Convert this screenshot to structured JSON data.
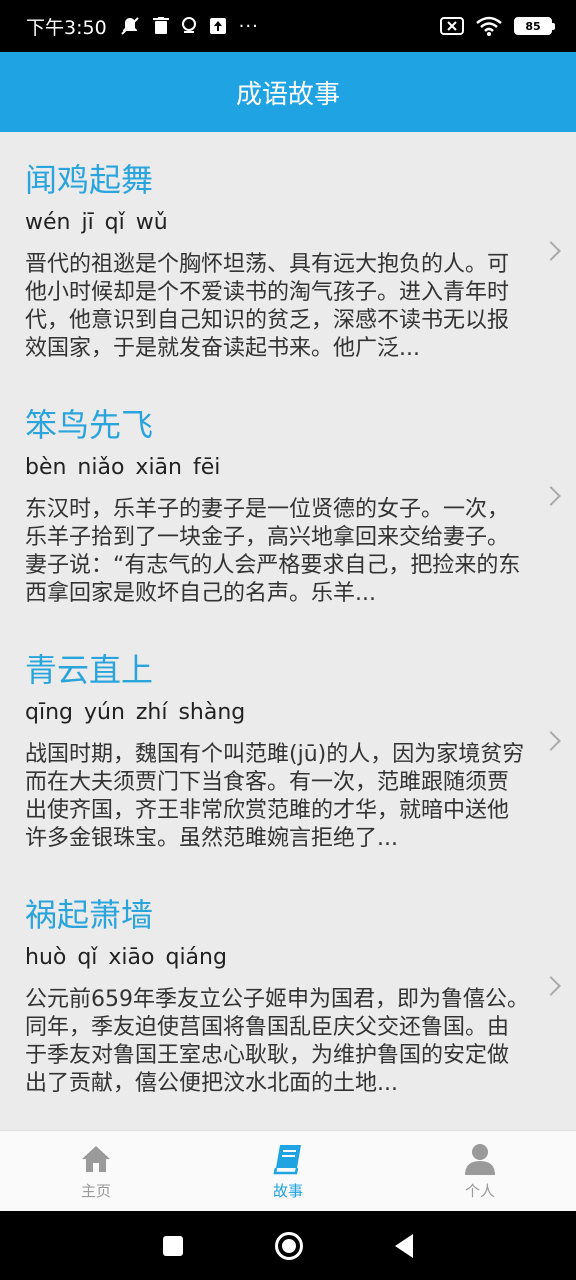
{
  "status_bar": {
    "time": "下午3:50",
    "more": "···",
    "battery": "85"
  },
  "app_bar": {
    "title": "成语故事"
  },
  "stories": [
    {
      "title": "闻鸡起舞",
      "pinyin": "wén jī qǐ wǔ",
      "text": "晋代的祖逖是个胸怀坦荡、具有远大抱负的人。可他小时候却是个不爱读书的淘气孩子。进入青年时代，他意识到自己知识的贫乏，深感不读书无以报效国家，于是就发奋读起书来。他广泛..."
    },
    {
      "title": "笨鸟先飞",
      "pinyin": "bèn niǎo xiān fēi",
      "text": "东汉时，乐羊子的妻子是一位贤德的女子。一次，乐羊子拾到了一块金子，高兴地拿回来交给妻子。妻子说：“有志气的人会严格要求自己，把捡来的东西拿回家是败坏自己的名声。乐羊..."
    },
    {
      "title": "青云直上",
      "pinyin": "qīng yún zhí shàng",
      "text": "战国时期，魏国有个叫范雎(jū)的人，因为家境贫穷而在大夫须贾门下当食客。有一次，范雎跟随须贾出使齐国，齐王非常欣赏范雎的才华，就暗中送他许多金银珠宝。虽然范雎婉言拒绝了..."
    },
    {
      "title": "祸起萧墙",
      "pinyin": "huò qǐ xiāo qiáng",
      "text": "公元前659年季友立公子姬申为国君，即为鲁僖公。同年，季友迫使莒国将鲁国乱臣庆父交还鲁国。由于季友对鲁国王室忠心耿耿，为维护鲁国的安定做出了贡献，僖公便把汶水北面的土地..."
    }
  ],
  "tabs": [
    {
      "label": "主页",
      "icon": "home-icon"
    },
    {
      "label": "故事",
      "icon": "book-icon",
      "active": true
    },
    {
      "label": "个人",
      "icon": "person-icon"
    }
  ],
  "colors": {
    "accent": "#1fa3e3",
    "title": "#2aa4dc"
  }
}
